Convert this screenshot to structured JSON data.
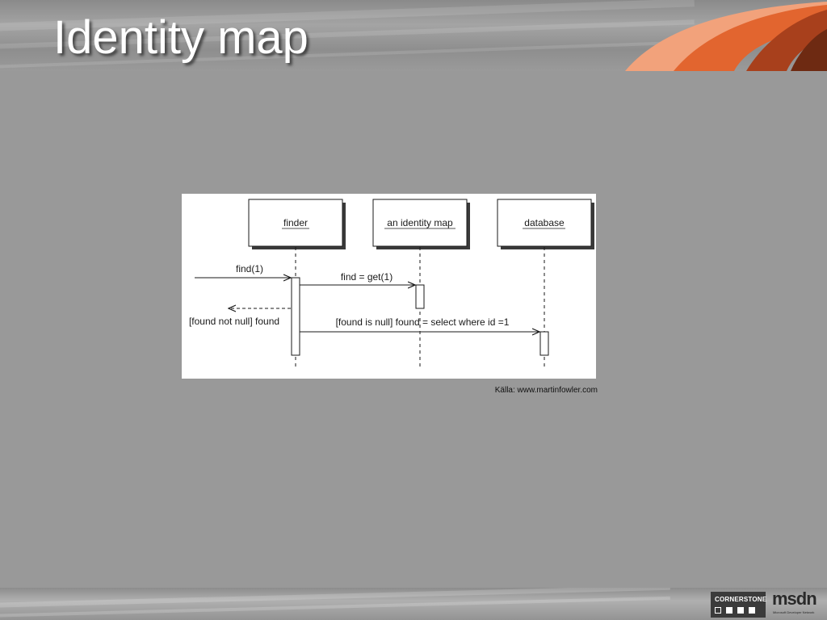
{
  "slide": {
    "title": "Identity map",
    "source": "Källa: www.martinfowler.com"
  },
  "diagram": {
    "participants": [
      {
        "name": "finder"
      },
      {
        "name": "an identity map"
      },
      {
        "name": "database"
      }
    ],
    "messages": [
      {
        "label": "find(1)"
      },
      {
        "label": "find = get(1)"
      },
      {
        "label": "[found not null] found"
      },
      {
        "label": "[found is null] found = select where id =1"
      }
    ]
  },
  "logos": {
    "cornerstone": "CORNERSTONE",
    "msdn": "msdn",
    "msdn_sub": "Microsoft Developer Network"
  },
  "colors": {
    "background": "#999999",
    "accent_orange": "#e8703a",
    "accent_dark": "#7a2e14",
    "title": "#ffffff"
  }
}
